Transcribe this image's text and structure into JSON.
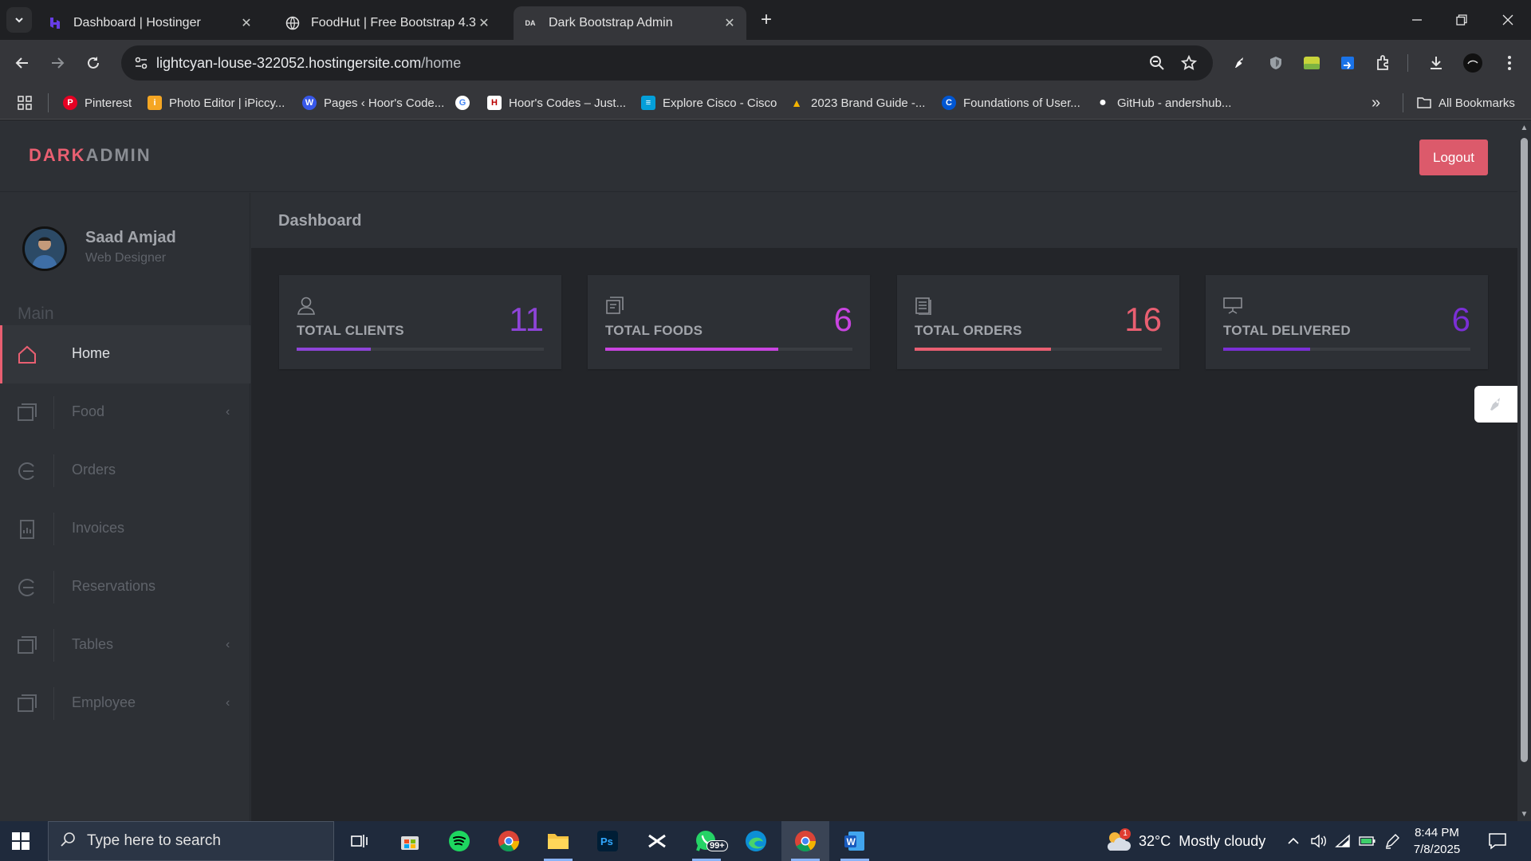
{
  "browser": {
    "tabs": [
      {
        "title": "Dashboard | Hostinger",
        "close": "✕"
      },
      {
        "title": "FoodHut | Free Bootstrap 4.3.x",
        "close": "✕"
      },
      {
        "title": "Dark Bootstrap Admin",
        "close": "✕",
        "favicon_text": "DA"
      }
    ],
    "new_tab": "+",
    "url_host": "lightcyan-louse-322052.hostingersite.com",
    "url_path": "/home",
    "bookmarks": [
      {
        "label": "Pinterest",
        "icon": "pinterest-icon",
        "color": "#e60023",
        "glyph": "P"
      },
      {
        "label": "Photo Editor | iPiccy...",
        "icon": "ipiccy-icon",
        "color": "#f5a623",
        "glyph": "i"
      },
      {
        "label": "Pages ‹ Hoor's Code...",
        "icon": "wordpress-icon",
        "color": "#3858e9",
        "glyph": "W"
      },
      {
        "label": "",
        "icon": "google-icon",
        "color": "#ffffff",
        "glyph": "G"
      },
      {
        "label": "Hoor's Codes – Just...",
        "icon": "hoors-codes-icon",
        "color": "#ffffff",
        "glyph": "H"
      },
      {
        "label": "Explore Cisco - Cisco",
        "icon": "cisco-icon",
        "color": "#049fd9",
        "glyph": "≡"
      },
      {
        "label": "2023 Brand Guide -...",
        "icon": "google-drive-icon",
        "color": "#f4b400",
        "glyph": "▲"
      },
      {
        "label": "Foundations of User...",
        "icon": "coursera-icon",
        "color": "#0056d2",
        "glyph": "C"
      },
      {
        "label": "GitHub - andershub...",
        "icon": "github-icon",
        "color": "#ffffff",
        "glyph": "●"
      }
    ],
    "more_bookmarks": "»",
    "all_bookmarks": "All Bookmarks"
  },
  "app": {
    "brand_part1": "DARK",
    "brand_part2": "ADMIN",
    "logout": "Logout",
    "user_name": "Saad Amjad",
    "user_role": "Web Designer",
    "section_label": "Main",
    "breadcrumb": "Dashboard",
    "nav": [
      {
        "label": "Home",
        "icon": "home-icon",
        "active": true
      },
      {
        "label": "Food",
        "icon": "food-icon",
        "chevron": "‹"
      },
      {
        "label": "Orders",
        "icon": "orders-icon"
      },
      {
        "label": "Invoices",
        "icon": "invoices-icon"
      },
      {
        "label": "Reservations",
        "icon": "reservations-icon"
      },
      {
        "label": "Tables",
        "icon": "tables-icon",
        "chevron": "‹"
      },
      {
        "label": "Employee",
        "icon": "employee-icon",
        "chevron": "‹"
      }
    ],
    "cards": [
      {
        "title": "TOTAL CLIENTS",
        "value": "11",
        "icon": "user-icon",
        "color": "#8e44d8",
        "progress": 0.3
      },
      {
        "title": "TOTAL FOODS",
        "value": "6",
        "icon": "food-icon",
        "color": "#c944e0",
        "progress": 0.7
      },
      {
        "title": "TOTAL ORDERS",
        "value": "16",
        "icon": "orders-icon",
        "color": "#e95f71",
        "progress": 0.55
      },
      {
        "title": "TOTAL DELIVERED",
        "value": "6",
        "icon": "delivered-icon",
        "color": "#7b2fd6",
        "progress": 0.35
      }
    ]
  },
  "taskbar": {
    "search_placeholder": "Type here to search",
    "weather_badge": "1",
    "weather": "32°C  Mostly cloudy",
    "time": "8:44 PM",
    "date": "7/8/2025",
    "whatsapp_badge": "99+"
  }
}
